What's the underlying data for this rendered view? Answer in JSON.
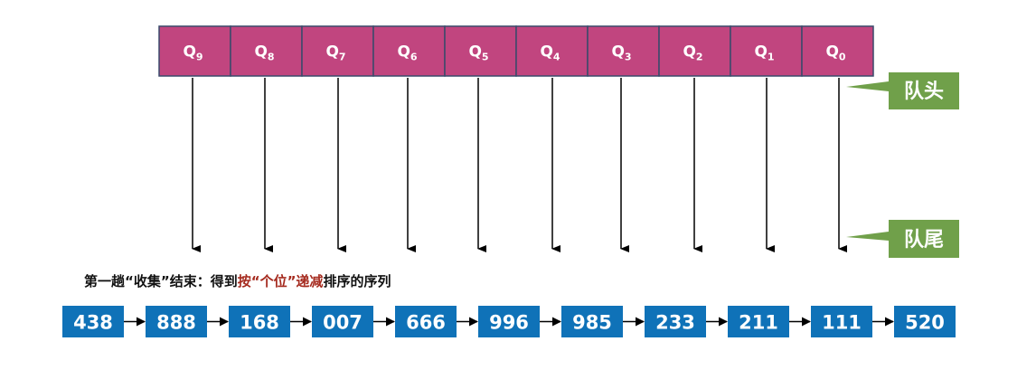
{
  "colors": {
    "bucket_fill": "#C1457F",
    "bucket_border": "#3A4A6B",
    "label_fill": "#70A04A",
    "node_fill": "#0F72B8",
    "caption_text": "#111111",
    "caption_highlight": "#A52A1E",
    "arrow": "#000000"
  },
  "queues": [
    {
      "letter": "Q",
      "sub": "9"
    },
    {
      "letter": "Q",
      "sub": "8"
    },
    {
      "letter": "Q",
      "sub": "7"
    },
    {
      "letter": "Q",
      "sub": "6"
    },
    {
      "letter": "Q",
      "sub": "5"
    },
    {
      "letter": "Q",
      "sub": "4"
    },
    {
      "letter": "Q",
      "sub": "3"
    },
    {
      "letter": "Q",
      "sub": "2"
    },
    {
      "letter": "Q",
      "sub": "1"
    },
    {
      "letter": "Q",
      "sub": "0"
    }
  ],
  "labels": {
    "head": "队头",
    "tail": "队尾"
  },
  "caption": {
    "part1": "第一趟“收集”结束：得到",
    "highlight": "按“个位”递减",
    "part2": "排序的序列"
  },
  "sequence": [
    "438",
    "888",
    "168",
    "007",
    "666",
    "996",
    "985",
    "233",
    "211",
    "111",
    "520"
  ]
}
